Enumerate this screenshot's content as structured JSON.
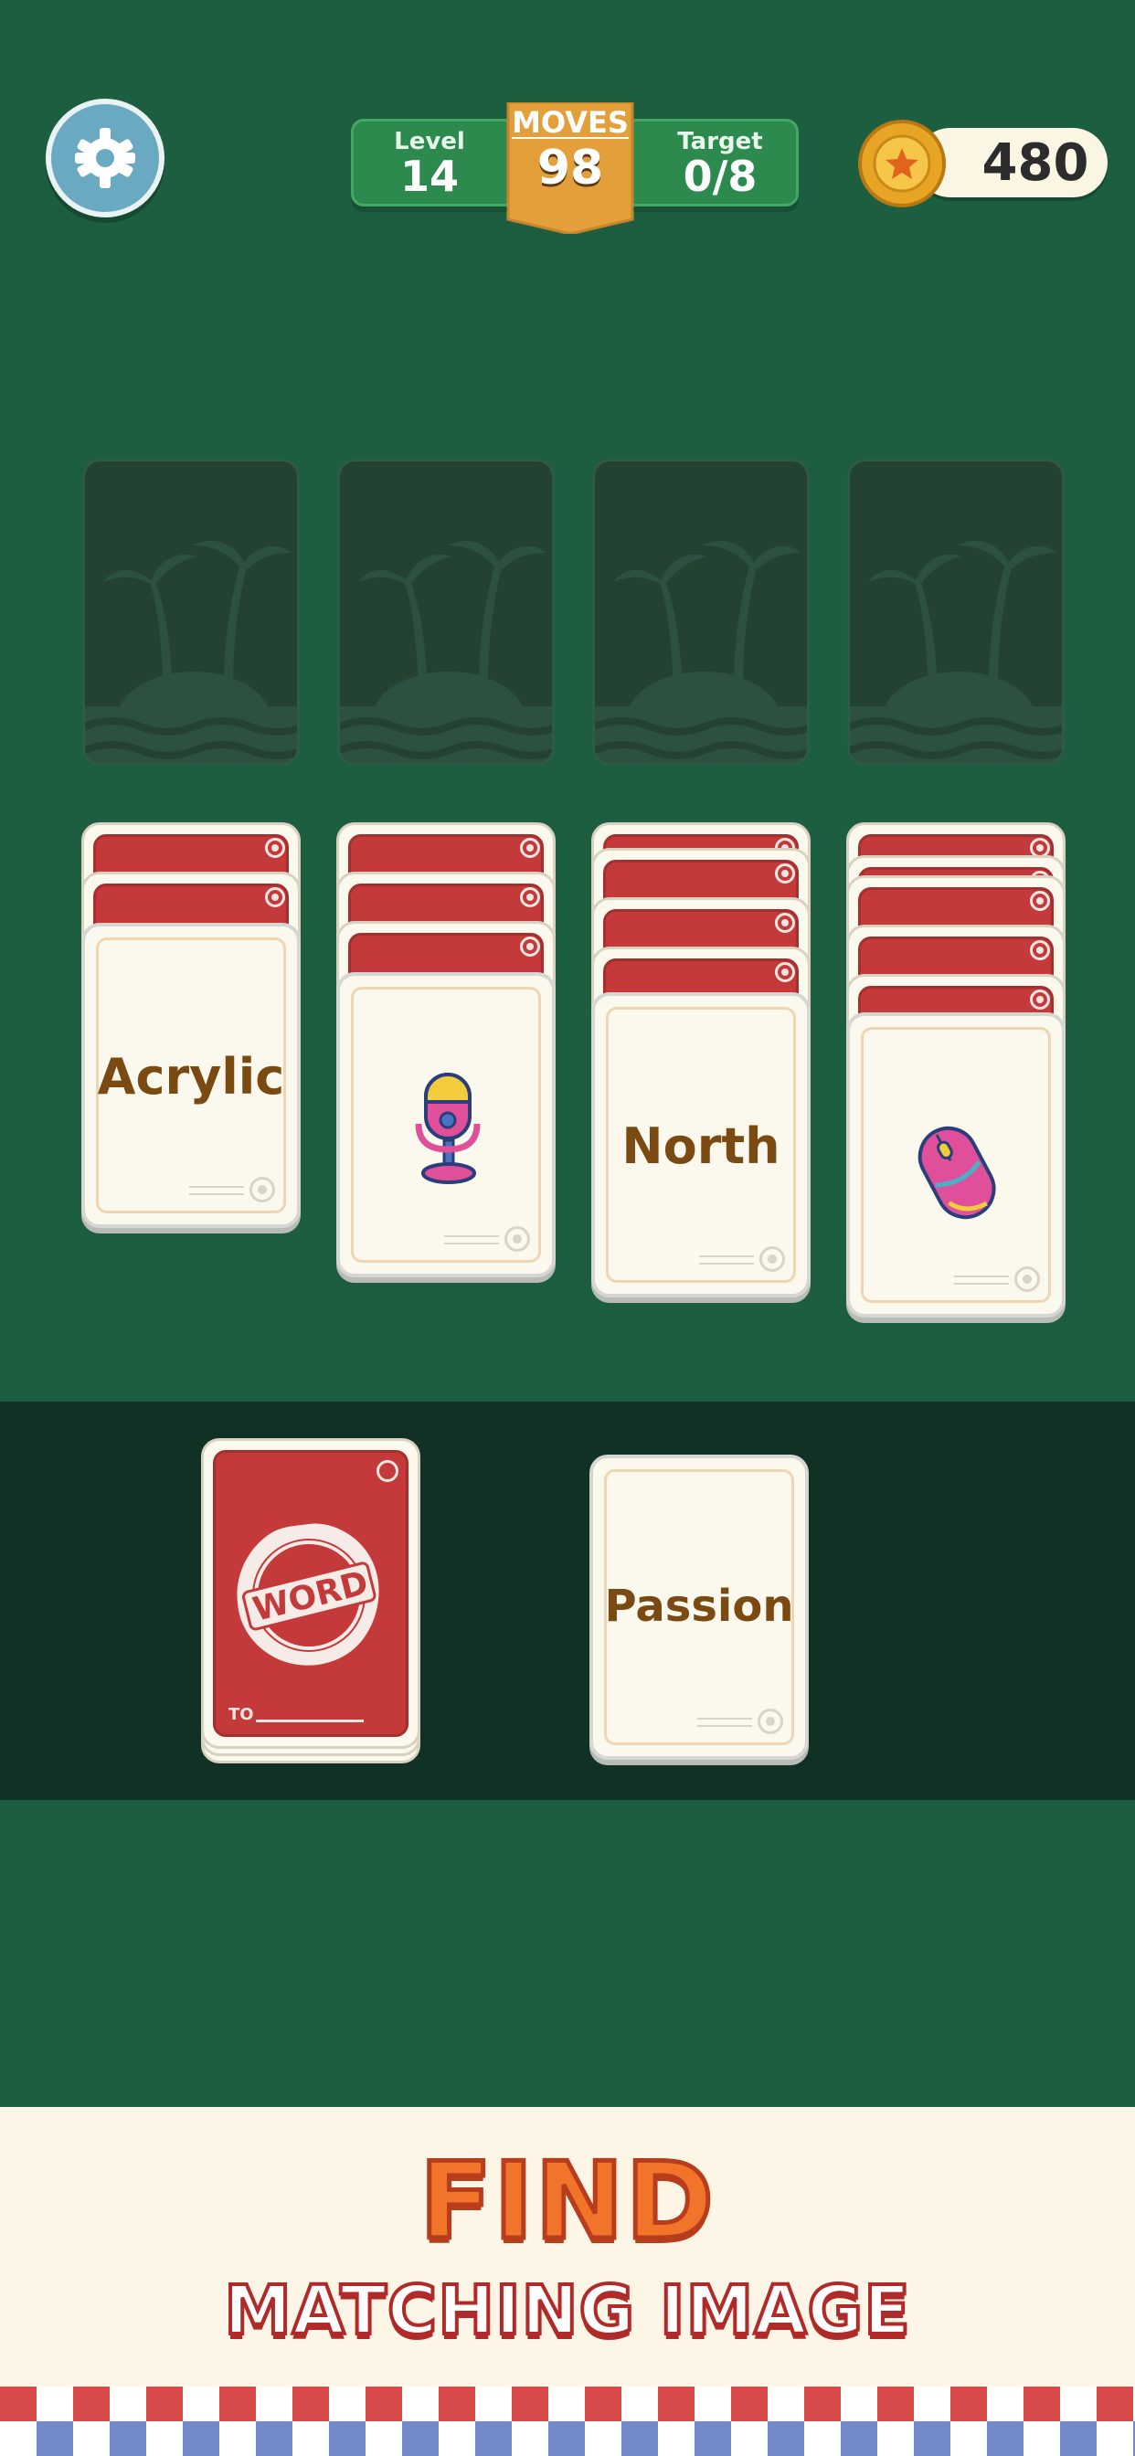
{
  "hud": {
    "level_label": "Level",
    "level_value": "14",
    "moves_label": "MOVES",
    "moves_value": "98",
    "target_label": "Target",
    "target_value": "0/8",
    "coins": "480"
  },
  "foundation_slots": 4,
  "tableau": [
    {
      "hidden_cards": 2,
      "top_card": {
        "type": "word",
        "text": "Acrylic"
      }
    },
    {
      "hidden_cards": 3,
      "top_card": {
        "type": "image",
        "icon": "microphone-icon"
      }
    },
    {
      "hidden_cards": 4,
      "top_card": {
        "type": "word",
        "text": "North"
      }
    },
    {
      "hidden_cards": 4,
      "top_card": {
        "type": "image",
        "icon": "computer-mouse-icon"
      }
    }
  ],
  "stock": {
    "stamp_text": "WORD",
    "to_label": "TO"
  },
  "waste": {
    "type": "word",
    "text": "Passion"
  },
  "banner": {
    "line1": "FIND",
    "line2": "MATCHING IMAGE"
  },
  "colors": {
    "table_green": "#1e5e40",
    "stock_strip": "#103124",
    "card_back_red": "#c43a3a",
    "card_word_brown": "#7a4a12",
    "moves_gold": "#e3a03a",
    "banner_orange": "#f2742a"
  }
}
